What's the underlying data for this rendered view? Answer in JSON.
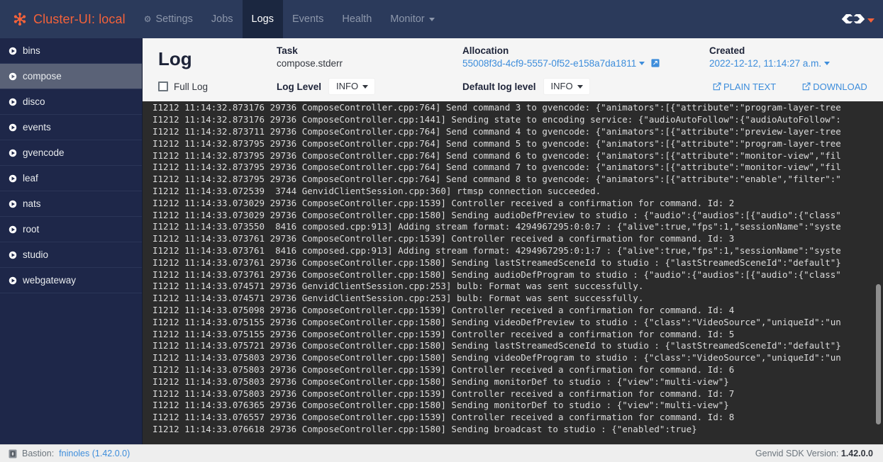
{
  "navbar": {
    "brand": "Cluster-UI: local",
    "brand_icon": "asterisk-logo-icon",
    "brand_color": "#f4623a",
    "items": [
      {
        "label": "Settings",
        "icon": "gear-icon",
        "active": false
      },
      {
        "label": "Jobs",
        "icon": "",
        "active": false
      },
      {
        "label": "Logs",
        "icon": "",
        "active": true
      },
      {
        "label": "Events",
        "icon": "",
        "active": false
      },
      {
        "label": "Health",
        "icon": "",
        "active": false
      },
      {
        "label": "Monitor",
        "icon": "chevron-down-icon",
        "active": false
      }
    ],
    "right_logo": "genvid-logo-icon"
  },
  "sidebar": {
    "items": [
      {
        "label": "bins",
        "active": false
      },
      {
        "label": "compose",
        "active": true
      },
      {
        "label": "disco",
        "active": false
      },
      {
        "label": "events",
        "active": false
      },
      {
        "label": "gvencode",
        "active": false
      },
      {
        "label": "leaf",
        "active": false
      },
      {
        "label": "nats",
        "active": false
      },
      {
        "label": "root",
        "active": false
      },
      {
        "label": "studio",
        "active": false
      },
      {
        "label": "webgateway",
        "active": false
      }
    ]
  },
  "log_panel": {
    "title": "Log",
    "task_label": "Task",
    "task_value": "compose.stderr",
    "allocation_label": "Allocation",
    "allocation_value": "55008f3d-4cf9-5557-0f52-e158a7da1811",
    "created_label": "Created",
    "created_value": "2022-12-12, 11:14:27 a.m.",
    "full_log_label": "Full Log",
    "full_log_checked": false,
    "log_level_label": "Log Level",
    "log_level_value": "INFO",
    "default_log_level_label": "Default log level",
    "default_log_level_value": "INFO",
    "plain_text_label": "PLAIN TEXT",
    "download_label": "DOWNLOAD",
    "lines": [
      "I1212 11:14:32.873176 29736 ComposeController.cpp:764] Send command 3 to gvencode: {\"animators\":[{\"attribute\":\"program-layer-tree",
      "I1212 11:14:32.873176 29736 ComposeController.cpp:1441] Sending state to encoding service: {\"audioAutoFollow\":{\"audioAutoFollow\":",
      "I1212 11:14:32.873711 29736 ComposeController.cpp:764] Send command 4 to gvencode: {\"animators\":[{\"attribute\":\"preview-layer-tree",
      "I1212 11:14:32.873795 29736 ComposeController.cpp:764] Send command 5 to gvencode: {\"animators\":[{\"attribute\":\"program-layer-tree",
      "I1212 11:14:32.873795 29736 ComposeController.cpp:764] Send command 6 to gvencode: {\"animators\":[{\"attribute\":\"monitor-view\",\"fil",
      "I1212 11:14:32.873795 29736 ComposeController.cpp:764] Send command 7 to gvencode: {\"animators\":[{\"attribute\":\"monitor-view\",\"fil",
      "I1212 11:14:32.873795 29736 ComposeController.cpp:764] Send command 8 to gvencode: {\"animators\":[{\"attribute\":\"enable\",\"filter\":\"",
      "I1212 11:14:33.072539  3744 GenvidClientSession.cpp:360] rtmsp connection succeeded.",
      "I1212 11:14:33.073029 29736 ComposeController.cpp:1539] Controller received a confirmation for command. Id: 2",
      "I1212 11:14:33.073029 29736 ComposeController.cpp:1580] Sending audioDefPreview to studio : {\"audio\":{\"audios\":[{\"audio\":{\"class\"",
      "I1212 11:14:33.073550  8416 composed.cpp:913] Adding stream format: 4294967295:0:0:7 : {\"alive\":true,\"fps\":1,\"sessionName\":\"syste",
      "I1212 11:14:33.073761 29736 ComposeController.cpp:1539] Controller received a confirmation for command. Id: 3",
      "I1212 11:14:33.073761  8416 composed.cpp:913] Adding stream format: 4294967295:0:1:7 : {\"alive\":true,\"fps\":1,\"sessionName\":\"syste",
      "I1212 11:14:33.073761 29736 ComposeController.cpp:1580] Sending lastStreamedSceneId to studio : {\"lastStreamedSceneId\":\"default\"}",
      "I1212 11:14:33.073761 29736 ComposeController.cpp:1580] Sending audioDefProgram to studio : {\"audio\":{\"audios\":[{\"audio\":{\"class\"",
      "I1212 11:14:33.074571 29736 GenvidClientSession.cpp:253] bulb: Format was sent successfully.",
      "I1212 11:14:33.074571 29736 GenvidClientSession.cpp:253] bulb: Format was sent successfully.",
      "I1212 11:14:33.075098 29736 ComposeController.cpp:1539] Controller received a confirmation for command. Id: 4",
      "I1212 11:14:33.075155 29736 ComposeController.cpp:1580] Sending videoDefPreview to studio : {\"class\":\"VideoSource\",\"uniqueId\":\"un",
      "I1212 11:14:33.075155 29736 ComposeController.cpp:1539] Controller received a confirmation for command. Id: 5",
      "I1212 11:14:33.075721 29736 ComposeController.cpp:1580] Sending lastStreamedSceneId to studio : {\"lastStreamedSceneId\":\"default\"}",
      "I1212 11:14:33.075803 29736 ComposeController.cpp:1580] Sending videoDefProgram to studio : {\"class\":\"VideoSource\",\"uniqueId\":\"un",
      "I1212 11:14:33.075803 29736 ComposeController.cpp:1539] Controller received a confirmation for command. Id: 6",
      "I1212 11:14:33.075803 29736 ComposeController.cpp:1580] Sending monitorDef to studio : {\"view\":\"multi-view\"}",
      "I1212 11:14:33.075803 29736 ComposeController.cpp:1539] Controller received a confirmation for command. Id: 7",
      "I1212 11:14:33.076365 29736 ComposeController.cpp:1580] Sending monitorDef to studio : {\"view\":\"multi-view\"}",
      "I1212 11:14:33.076557 29736 ComposeController.cpp:1539] Controller received a confirmation for command. Id: 8",
      "I1212 11:14:33.076618 29736 ComposeController.cpp:1580] Sending broadcast to studio : {\"enabled\":true}"
    ]
  },
  "footer": {
    "bastion_label": "Bastion:",
    "bastion_value": "fninoles (1.42.0.0)",
    "sdk_label": "Genvid SDK Version:",
    "sdk_value": "1.42.0.0"
  }
}
